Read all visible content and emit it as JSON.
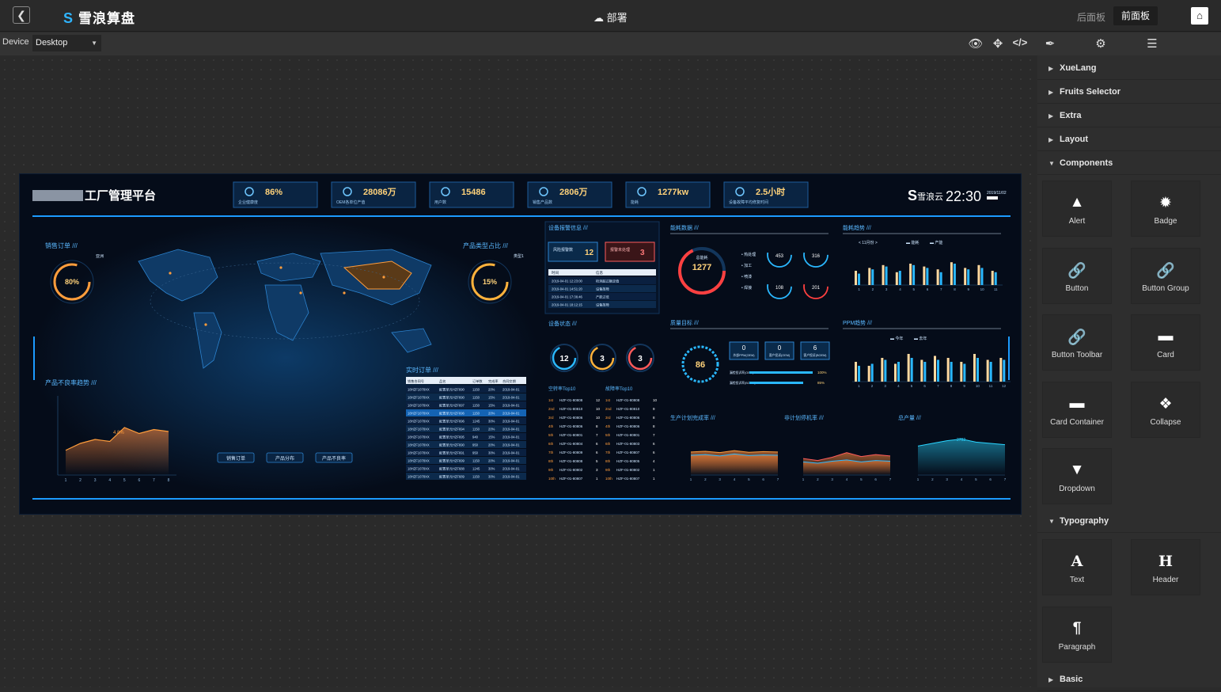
{
  "topbar": {
    "back_icon": "chevron-left-icon",
    "logo_text": "雪浪算盘",
    "deploy_label": "部署",
    "back_panel": "后面板",
    "front_panel": "前面板",
    "home_icon": "home-icon"
  },
  "toolbar": {
    "device_label": "Device",
    "device_value": "Desktop",
    "tools": [
      "eye-icon",
      "move-icon",
      "code-icon",
      "brush-icon",
      "gear-icon",
      "menu-icon",
      "grid-icon"
    ]
  },
  "dashboard": {
    "title": "工厂管理平台",
    "brand": "雪浪云",
    "time": "22:30",
    "date": "2019/11/02",
    "kpis": [
      {
        "value": "86%",
        "label": "企业健康度"
      },
      {
        "value": "28086万",
        "label": "OEM各单位产值"
      },
      {
        "value": "15486",
        "label": "用户数"
      },
      {
        "value": "2806万",
        "label": "销售产品数"
      },
      {
        "value": "1277kw",
        "label": "能耗"
      },
      {
        "value": "2.5小时",
        "label": "设备故障平均修复时间"
      }
    ],
    "left_panel": {
      "sales_title": "销售订单",
      "sales_gauge": "80%",
      "sales_region": "亚洲",
      "type_title": "产品类型占比",
      "type_gauge": "15%",
      "type_label": "类型1",
      "defect_title": "产品不良率趋势",
      "defect_peak": "4.8%",
      "orders_title": "实时订单",
      "order_headers": [
        "销售合同号",
        "品名",
        "订单数",
        "完成率",
        "合同交期"
      ],
      "order_rows": [
        [
          "18HZF1078XX",
          "配置单元HZF690",
          "1150",
          "20%",
          "2019-04-01"
        ],
        [
          "18HZF1078XX",
          "配置单元HZF690",
          "1150",
          "15%",
          "2019-04-01"
        ],
        [
          "18HZF1078XX",
          "配置单元HZF697",
          "1150",
          "15%",
          "2019-04-01"
        ],
        [
          "18HZF1078XX",
          "配置单元HZF696",
          "1150",
          "20%",
          "2019-04-01"
        ],
        [
          "18HZF1078XX",
          "配置单元HZF696",
          "1245",
          "30%",
          "2019-04-01"
        ],
        [
          "18HZF1078XX",
          "配置单元HZF694",
          "1150",
          "20%",
          "2019-04-01"
        ],
        [
          "18HZF1078XX",
          "配置单元HZF695",
          "940",
          "15%",
          "2019-04-01"
        ],
        [
          "18HZF1078XX",
          "配置单元HZF690",
          "950",
          "20%",
          "2019-04-01"
        ],
        [
          "18HZF1078XX",
          "配置单元HZF691",
          "950",
          "30%",
          "2019-04-01"
        ],
        [
          "18HZF1078XX",
          "配置单元HZF699",
          "1150",
          "20%",
          "2019-04-01"
        ],
        [
          "18HZF1078XX",
          "配置单元HZF688",
          "1245",
          "30%",
          "2019-04-01"
        ],
        [
          "18HZF1078XX",
          "配置单元HZF689",
          "1150",
          "30%",
          "2019-04-01"
        ]
      ],
      "tabs": [
        "销售订单",
        "产品分布",
        "产品不良率"
      ]
    },
    "middle_panel": {
      "alarm_title": "设备报警信息",
      "alarm_risk_label": "风险报警数",
      "alarm_risk_value": "12",
      "alarm_pending_label": "报警未处理",
      "alarm_pending_value": "3",
      "alarm_headers": [
        "时间",
        "信息"
      ],
      "alarm_rows": [
        [
          "2019-04-01 12:23:00",
          "检测超过额定值"
        ],
        [
          "2019-04-01 14:51:20",
          "设备故障"
        ],
        [
          "2019-04-01 17:36:46",
          "产能过低"
        ],
        [
          "2019-04-01 18:12:15",
          "设备故障"
        ]
      ],
      "status_title": "设备状态",
      "status_values": [
        "12",
        "3",
        "3"
      ],
      "idle_title": "空转率Top10",
      "fault_title": "故障率Top10",
      "idle_rows": [
        [
          "1st",
          "HZF-01-80808",
          "12"
        ],
        [
          "2nd",
          "HZF-01-80810",
          "10"
        ],
        [
          "3rd",
          "HZF-01-80806",
          "10"
        ],
        [
          "4th",
          "HZF-01-80806",
          "8"
        ],
        [
          "5th",
          "HZF-01-80801",
          "7"
        ],
        [
          "6th",
          "HZF-01-80804",
          "6"
        ],
        [
          "7th",
          "HZF-01-80809",
          "6"
        ],
        [
          "8th",
          "HZF-01-80808",
          "5"
        ],
        [
          "9th",
          "HZF-01-80802",
          "3"
        ],
        [
          "10th",
          "HZF-01-80807",
          "1"
        ]
      ],
      "fault_rows": [
        [
          "1st",
          "HZF-01-80808",
          "10"
        ],
        [
          "2nd",
          "HZF-01-80810",
          "9"
        ],
        [
          "3rd",
          "HZF-01-80806",
          "8"
        ],
        [
          "4th",
          "HZF-01-80806",
          "8"
        ],
        [
          "5th",
          "HZF-01-80801",
          "7"
        ],
        [
          "6th",
          "HZF-01-80803",
          "6"
        ],
        [
          "7th",
          "HZF-01-80807",
          "6"
        ],
        [
          "8th",
          "HZF-01-80805",
          "4"
        ],
        [
          "9th",
          "HZF-01-80802",
          "1"
        ],
        [
          "10th",
          "HZF-01-80807",
          "1"
        ]
      ]
    },
    "right_panel": {
      "energy_title": "能耗数据",
      "energy_total": "1277",
      "energy_total_label": "总能耗",
      "energy_small": [
        "453",
        "316",
        "108",
        "201"
      ],
      "energy_legend": [
        "热处理",
        "加工",
        "喷漆",
        "焊接"
      ],
      "trend_title": "能耗趋势",
      "trend_legend": [
        "能耗",
        "产能"
      ],
      "trend_period": "< 11月份 >",
      "quality_title": "质量目标",
      "quality_gauge": "86",
      "quality_boxes": [
        {
          "value": "0",
          "label": "外部PPM(OEM)"
        },
        {
          "value": "0",
          "label": "客户投诉(OEM)"
        },
        {
          "value": "6",
          "label": "客户投诉(BOEM)"
        }
      ],
      "quality_bars": [
        {
          "label": "漏检投诉率(OEM)",
          "value": "100%"
        },
        {
          "label": "漏检投诉率(BOEM)",
          "value": "85%"
        }
      ],
      "ppm_title": "PPM趋势",
      "ppm_legend": [
        "今年",
        "去年"
      ],
      "plan_title": "生产计划完成率",
      "unplanned_title": "非计划停机率",
      "output_title": "总产量",
      "output_peak": "2732"
    }
  },
  "sidebar": {
    "categories": [
      "XueLang",
      "Fruits Selector",
      "Extra",
      "Layout",
      "Components",
      "Typography",
      "Basic"
    ],
    "components": [
      {
        "label": "Alert",
        "icon": "alert-icon"
      },
      {
        "label": "Badge",
        "icon": "badge-icon"
      },
      {
        "label": "Button",
        "icon": "link-icon"
      },
      {
        "label": "Button Group",
        "icon": "link-icon"
      },
      {
        "label": "Button Toolbar",
        "icon": "link-icon"
      },
      {
        "label": "Card",
        "icon": "card-icon"
      },
      {
        "label": "Card Container",
        "icon": "card-icon"
      },
      {
        "label": "Collapse",
        "icon": "collapse-icon"
      },
      {
        "label": "Dropdown",
        "icon": "caret-down-icon"
      }
    ],
    "typography": [
      {
        "label": "Text",
        "icon": "text-icon"
      },
      {
        "label": "Header",
        "icon": "header-icon"
      },
      {
        "label": "Paragraph",
        "icon": "paragraph-icon"
      }
    ]
  },
  "chart_data": [
    {
      "type": "line",
      "title": "产品不良率趋势",
      "categories": [
        "1",
        "2",
        "3",
        "4",
        "5",
        "6",
        "7",
        "8"
      ],
      "series": [
        {
          "values": [
            2.5,
            3.2,
            3.6,
            3.4,
            4.8,
            4.2,
            4.6,
            4.4
          ]
        }
      ],
      "ylim": [
        0,
        8
      ]
    },
    {
      "type": "bar",
      "title": "能耗趋势",
      "categories": [
        "1",
        "2",
        "3",
        "4",
        "5",
        "6",
        "7",
        "8",
        "9",
        "10",
        "11"
      ],
      "series": [
        {
          "name": "能耗",
          "values": [
            1000,
            1200,
            1400,
            900,
            1500,
            1300,
            1100,
            1600,
            1200,
            1400,
            1000
          ]
        },
        {
          "name": "产能",
          "values": [
            800,
            1100,
            1300,
            1000,
            1400,
            1200,
            900,
            1500,
            1100,
            1200,
            900
          ]
        }
      ],
      "ylim": [
        0,
        2500
      ]
    },
    {
      "type": "bar",
      "title": "PPM趋势",
      "categories": [
        "1",
        "2",
        "3",
        "4",
        "5",
        "6",
        "7",
        "8",
        "9",
        "10",
        "11",
        "12"
      ],
      "series": [
        {
          "name": "今年",
          "values": [
            50,
            40,
            60,
            45,
            70,
            55,
            65,
            60,
            50,
            70,
            55,
            60
          ]
        },
        {
          "name": "去年",
          "values": [
            40,
            45,
            55,
            50,
            60,
            50,
            55,
            50,
            45,
            60,
            50,
            55
          ]
        }
      ],
      "ylim": [
        0,
        100
      ]
    },
    {
      "type": "line",
      "title": "生产计划完成率",
      "categories": [
        "1",
        "2",
        "3",
        "4",
        "5",
        "6",
        "7"
      ],
      "series": [
        {
          "values": [
            70,
            72,
            68,
            74,
            69,
            71,
            70
          ]
        },
        {
          "values": [
            60,
            62,
            58,
            64,
            59,
            61,
            60
          ]
        }
      ],
      "ylim": [
        0,
        120
      ]
    },
    {
      "type": "line",
      "title": "非计划停机率",
      "categories": [
        "1",
        "2",
        "3",
        "4",
        "5",
        "6",
        "7"
      ],
      "series": [
        {
          "values": [
            2.5,
            2.2,
            2.7,
            3.4,
            2.8,
            3.1,
            2.9
          ]
        },
        {
          "values": [
            2.0,
            1.8,
            2.1,
            2.3,
            2.0,
            2.2,
            2.1
          ]
        }
      ],
      "ylim": [
        0,
        6
      ]
    },
    {
      "type": "area",
      "title": "总产量",
      "categories": [
        "1",
        "2",
        "3",
        "4",
        "5",
        "6",
        "7"
      ],
      "series": [
        {
          "values": [
            2200,
            2400,
            2600,
            2732,
            2500,
            2400,
            2300
          ]
        }
      ],
      "ylim": [
        0,
        3000
      ]
    }
  ]
}
